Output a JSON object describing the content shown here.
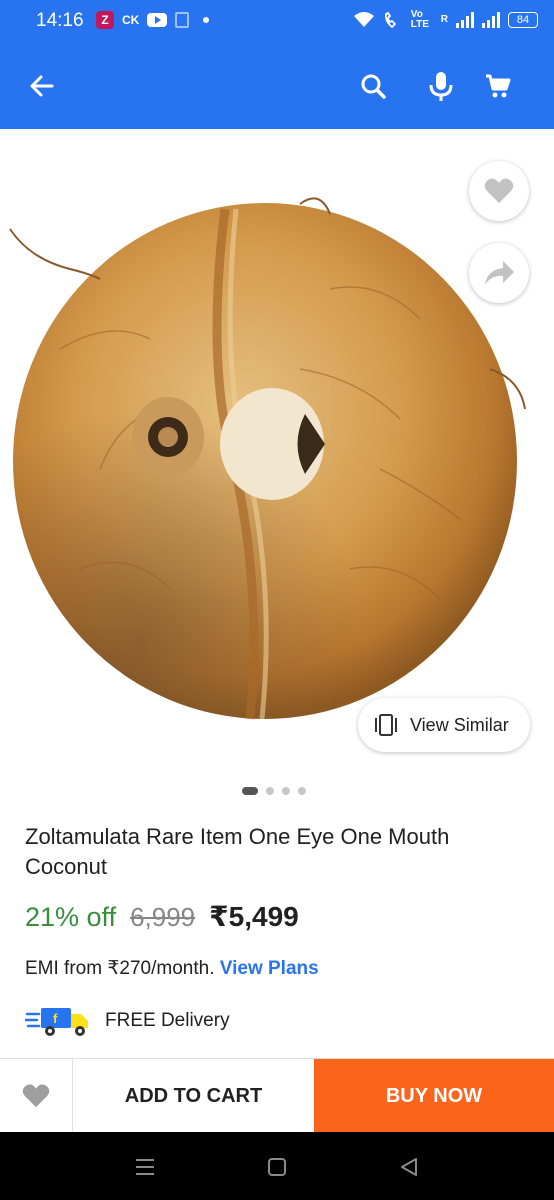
{
  "status_bar": {
    "time": "14:16",
    "app_z": "Z",
    "app_ck": "CK",
    "volte": "Vo LTE",
    "roaming": "R",
    "battery": "84"
  },
  "header": {
    "back_icon": "arrow-left-icon",
    "search_icon": "search-icon",
    "mic_icon": "microphone-icon",
    "cart_icon": "cart-icon",
    "background": "#2874f0"
  },
  "gallery": {
    "image": "coconut-product-photo",
    "view_similar_label": "View Similar",
    "slide_count": 4,
    "active_slide": 1
  },
  "product": {
    "title": "Zoltamulata Rare Item One Eye One Mouth Coconut",
    "discount": "21% off",
    "mrp": "6,999",
    "price": "₹5,499",
    "emi_text": "EMI from ₹270/month.",
    "emi_link": "View Plans",
    "delivery": "FREE Delivery"
  },
  "actions": {
    "add_to_cart": "ADD TO CART",
    "buy_now": "BUY NOW",
    "buy_now_color": "#fb641b"
  },
  "colors": {
    "brand_blue": "#2874f0",
    "discount_green": "#388e3c"
  }
}
